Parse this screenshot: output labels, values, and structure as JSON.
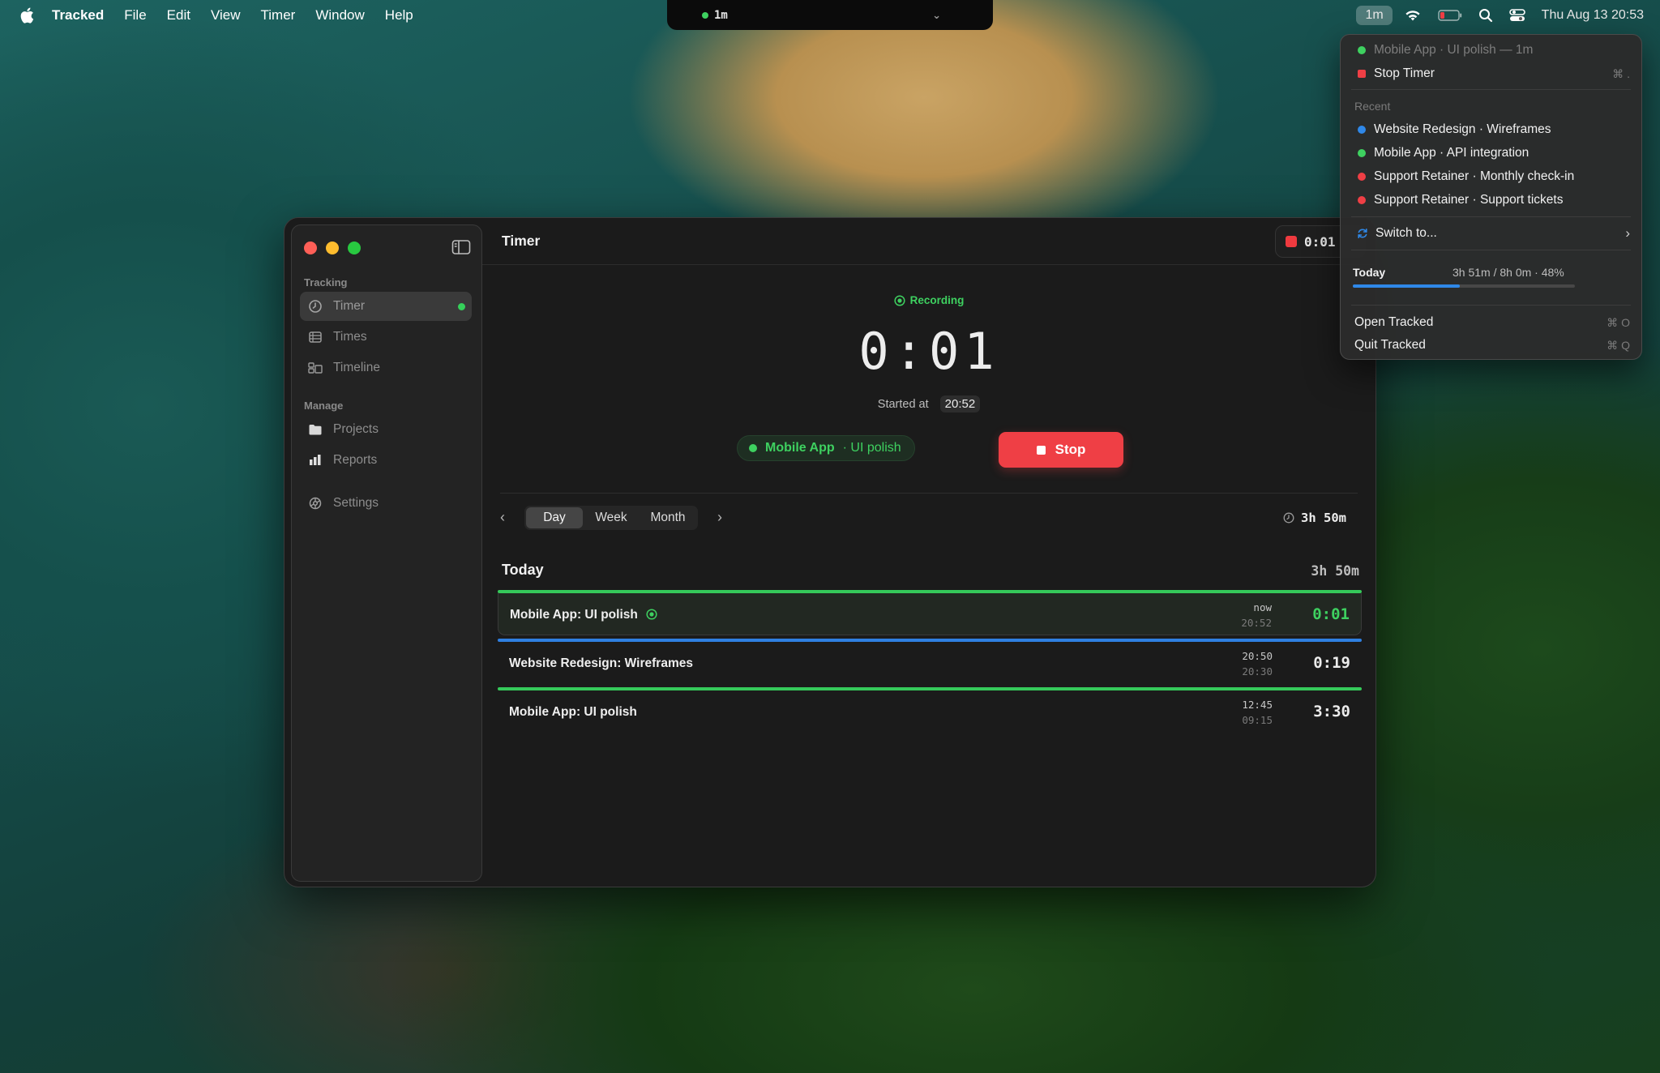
{
  "menubar": {
    "app_name": "Tracked",
    "menus": [
      "File",
      "Edit",
      "View",
      "Timer",
      "Window",
      "Help"
    ],
    "notch_label": "1m",
    "status_pill": "1m",
    "clock": "Thu Aug 13  20:53"
  },
  "sidebar": {
    "section_tracking": "Tracking",
    "section_manage": "Manage",
    "items": [
      {
        "label": "Timer",
        "icon": "timer-icon"
      },
      {
        "label": "Times",
        "icon": "list-icon"
      },
      {
        "label": "Timeline",
        "icon": "timeline-icon"
      },
      {
        "label": "Projects",
        "icon": "folder-icon"
      },
      {
        "label": "Reports",
        "icon": "chart-icon"
      },
      {
        "label": "Settings",
        "icon": "gear-icon"
      }
    ]
  },
  "header": {
    "title": "Timer",
    "mini_timer": "0:01"
  },
  "timer": {
    "status": "Recording",
    "elapsed": "0:01",
    "started_label": "Started at",
    "started_time": "20:52",
    "project": "Mobile App",
    "task": "· UI polish",
    "stop_label": "Stop"
  },
  "range": {
    "options": [
      "Day",
      "Week",
      "Month"
    ],
    "selected": "Day",
    "total": "3h 50m"
  },
  "today": {
    "heading": "Today",
    "total": "3h 50m",
    "entries": [
      {
        "title": "Mobile App: UI polish",
        "end": "now",
        "start": "20:52",
        "duration": "0:01",
        "color": "#35c95a",
        "active": true
      },
      {
        "title": "Website Redesign: Wireframes",
        "end": "20:50",
        "start": "20:30",
        "duration": "0:19",
        "color": "#2f7fe0",
        "active": false
      },
      {
        "title": "Mobile App: UI polish",
        "end": "12:45",
        "start": "09:15",
        "duration": "3:30",
        "color": "#35c95a",
        "active": false
      }
    ]
  },
  "dropdown": {
    "current": "Mobile App · UI polish — 1m",
    "stop": "Stop Timer",
    "stop_shortcut": "⌘ .",
    "recent_label": "Recent",
    "recent": [
      {
        "label": "Website Redesign · Wireframes",
        "color": "#2f88e8"
      },
      {
        "label": "Mobile App · API integration",
        "color": "#3ed160"
      },
      {
        "label": "Support Retainer · Monthly check-in",
        "color": "#ef3f45"
      },
      {
        "label": "Support Retainer · Support tickets",
        "color": "#ef3f45"
      }
    ],
    "switch": "Switch to...",
    "today_label": "Today",
    "today_value": "3h 51m / 8h 0m · 48%",
    "today_progress": 0.48,
    "open": "Open Tracked",
    "open_shortcut": "⌘ O",
    "quit": "Quit Tracked",
    "quit_shortcut": "⌘ Q"
  }
}
